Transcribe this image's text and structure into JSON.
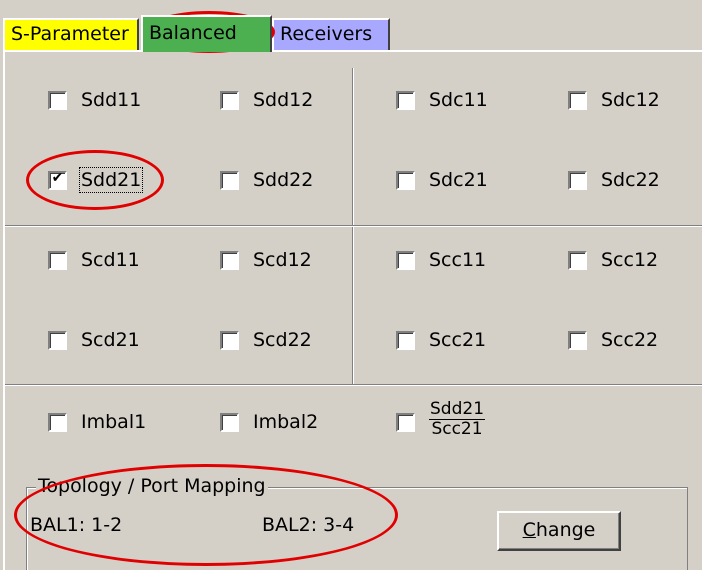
{
  "tabs": [
    {
      "label": "S-Parameter",
      "color": "#ffff00"
    },
    {
      "label": "Balanced",
      "color": "#4caf50"
    },
    {
      "label": "Receivers",
      "color": "#a8a8ff"
    }
  ],
  "checkboxes": {
    "sdd11": {
      "label": "Sdd11",
      "checked": false
    },
    "sdd12": {
      "label": "Sdd12",
      "checked": false
    },
    "sdc11": {
      "label": "Sdc11",
      "checked": false
    },
    "sdc12": {
      "label": "Sdc12",
      "checked": false
    },
    "sdd21": {
      "label": "Sdd21",
      "checked": true
    },
    "sdd22": {
      "label": "Sdd22",
      "checked": false
    },
    "sdc21": {
      "label": "Sdc21",
      "checked": false
    },
    "sdc22": {
      "label": "Sdc22",
      "checked": false
    },
    "scd11": {
      "label": "Scd11",
      "checked": false
    },
    "scd12": {
      "label": "Scd12",
      "checked": false
    },
    "scc11": {
      "label": "Scc11",
      "checked": false
    },
    "scc12": {
      "label": "Scc12",
      "checked": false
    },
    "scd21": {
      "label": "Scd21",
      "checked": false
    },
    "scd22": {
      "label": "Scd22",
      "checked": false
    },
    "scc21": {
      "label": "Scc21",
      "checked": false
    },
    "scc22": {
      "label": "Scc22",
      "checked": false
    },
    "imbal1": {
      "label": "Imbal1",
      "checked": false
    },
    "imbal2": {
      "label": "Imbal2",
      "checked": false
    },
    "ratio": {
      "numerator": "Sdd21",
      "denominator": "Scc21",
      "checked": false
    }
  },
  "check_glyph": "✔",
  "topology": {
    "title": "Topology / Port Mapping",
    "bal1": "BAL1: 1-2",
    "bal2": "BAL2: 3-4",
    "change_prefix": "C",
    "change_rest": "hange"
  },
  "annotation_color": "#e00000"
}
